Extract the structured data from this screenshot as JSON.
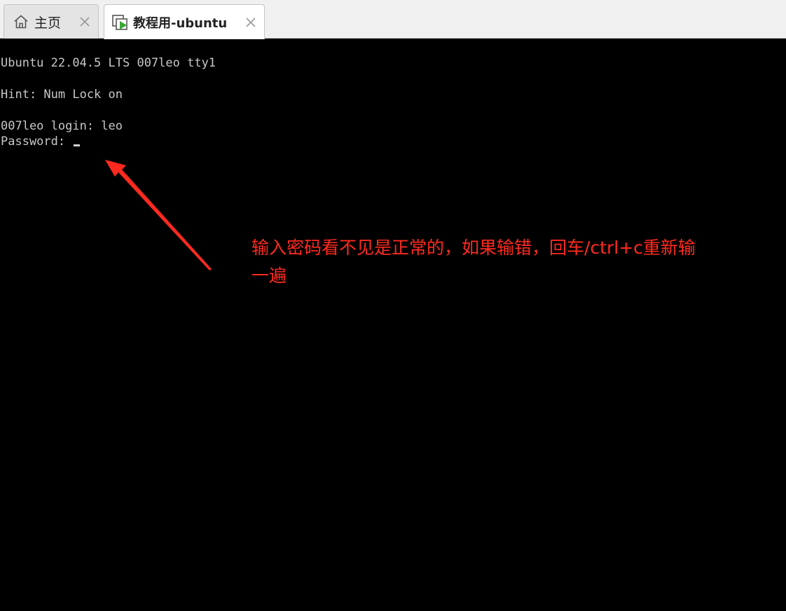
{
  "tabs": [
    {
      "label": "主页",
      "icon": "home-icon",
      "active": false
    },
    {
      "label": "教程用-ubuntu",
      "icon": "vm-running-icon",
      "active": true
    }
  ],
  "console": {
    "lines": [
      "Ubuntu 22.04.5 LTS 007leo tty1",
      "Hint: Num Lock on",
      "007leo login: leo",
      "Password: "
    ]
  },
  "annotation": {
    "line1": "输入密码看不见是正常的，如果输错，回车/ctrl+c重新输",
    "line2": "一遍",
    "color": "#ff2a1f"
  }
}
